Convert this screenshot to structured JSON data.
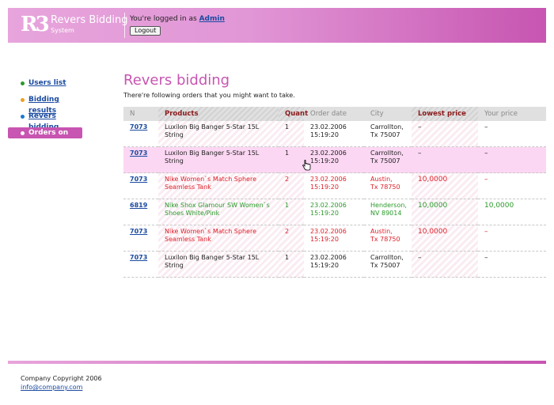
{
  "header": {
    "logo_mark": "R3",
    "title": "Revers Bidding",
    "subtitle": "System",
    "login_prefix": "You're logged in as",
    "user": "Admin",
    "logout": "Logout"
  },
  "nav": {
    "items": [
      {
        "label": "Users list",
        "color": "#2a9a2a"
      },
      {
        "label": "Bidding results",
        "color": "#f0a020"
      },
      {
        "label": "Revers bidding",
        "color": "#1a7ad0"
      },
      {
        "label": "Orders on me",
        "color": "#ffffff"
      }
    ]
  },
  "main": {
    "title": "Revers bidding",
    "subtitle": "There're following orders that you might want to take."
  },
  "table": {
    "headers": [
      "N",
      "Products",
      "Quant",
      "Order date",
      "City",
      "Lowest price",
      "Your price"
    ],
    "rows": [
      {
        "n": "7073",
        "product": "Luxilon Big Banger 5-Star 15L String",
        "quant": "1",
        "date": "23.02.2006",
        "time": "15:19:20",
        "city": "Carrollton,",
        "state": "Tx 75007",
        "lowest": "–",
        "yours": "–"
      },
      {
        "n": "7073",
        "product": "Luxilon Big Banger 5-Star 15L String",
        "quant": "1",
        "date": "23.02.2006",
        "time": "15:19:20",
        "city": "Carrollton,",
        "state": "Tx 75007",
        "lowest": "–",
        "yours": "–"
      },
      {
        "n": "7073",
        "product": "Nike Women`s Match Sphere Seamless Tank",
        "quant": "2",
        "date": "23.02.2006",
        "time": "15:19:20",
        "city": "Austin,",
        "state": "Tx 78750",
        "lowest": "10,0000",
        "yours": "–"
      },
      {
        "n": "6819",
        "product": "Nike Shox Glamour SW Women`s Shoes White/Pink",
        "quant": "1",
        "date": "23.02.2006",
        "time": "15:19:20",
        "city": "Henderson,",
        "state": "NV 89014",
        "lowest": "10,0000",
        "yours": "10,0000"
      },
      {
        "n": "7073",
        "product": "Nike Women`s Match Sphere Seamless Tank",
        "quant": "2",
        "date": "23.02.2006",
        "time": "15:19:20",
        "city": "Austin,",
        "state": "Tx 78750",
        "lowest": "10,0000",
        "yours": "–"
      },
      {
        "n": "7073",
        "product": "Luxilon Big Banger 5-Star 15L String",
        "quant": "1",
        "date": "23.02.2006",
        "time": "15:19:20",
        "city": "Carrollton,",
        "state": "Tx 75007",
        "lowest": "–",
        "yours": "–"
      }
    ]
  },
  "footer": {
    "copyright": "Company Copyright 2006",
    "email": "info@company.com"
  }
}
